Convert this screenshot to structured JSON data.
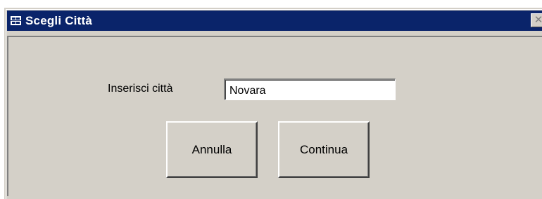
{
  "window": {
    "title": "Scegli Città",
    "close_glyph": "✕",
    "title_icon": "form-icon",
    "close_icon": "close-icon"
  },
  "form": {
    "city_label": "Inserisci città",
    "city_value": "Novara"
  },
  "buttons": {
    "cancel_label": "Annulla",
    "continue_label": "Continua"
  },
  "colors": {
    "titlebar": "#0a246a",
    "face": "#d4d0c8",
    "title_text": "#ffffff"
  }
}
